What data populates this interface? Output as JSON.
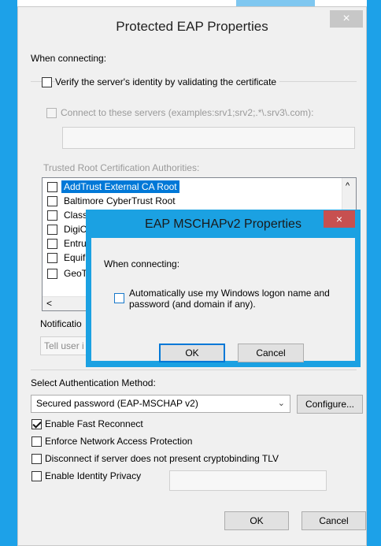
{
  "outer_dialog": {
    "title": "Protected EAP Properties",
    "close_glyph": "×",
    "when_connecting": "When connecting:",
    "verify_server_label": "Verify the server's identity by validating the certificate",
    "verify_server_checked": false,
    "connect_servers_label": "Connect to these servers (examples:srv1;srv2;.*\\.srv3\\.com):",
    "connect_servers_value": "",
    "trusted_root_label": "Trusted Root Certification Authorities:",
    "trusted_roots": [
      {
        "label": "AddTrust External CA Root",
        "checked": false,
        "selected": true
      },
      {
        "label": "Baltimore CyberTrust Root",
        "checked": false,
        "selected": false
      },
      {
        "label": "Class",
        "checked": false,
        "selected": false
      },
      {
        "label": "DigiC",
        "checked": false,
        "selected": false
      },
      {
        "label": "Entru",
        "checked": false,
        "selected": false
      },
      {
        "label": "Equif",
        "checked": false,
        "selected": false
      },
      {
        "label": "GeoT",
        "checked": false,
        "selected": false
      }
    ],
    "scroll_up_glyph": "^",
    "scroll_left_glyph": "<",
    "notifications_label": "Notificatio",
    "notifications_value": "Tell user i",
    "auth_method_label": "Select Authentication Method:",
    "auth_method_value": "Secured password (EAP-MSCHAP v2)",
    "dropdown_glyph": "⌄",
    "configure_button": "Configure...",
    "options": [
      {
        "label": "Enable Fast Reconnect",
        "checked": true
      },
      {
        "label": "Enforce Network Access Protection",
        "checked": false
      },
      {
        "label": "Disconnect if server does not present cryptobinding TLV",
        "checked": false
      },
      {
        "label": "Enable Identity Privacy",
        "checked": false
      }
    ],
    "identity_privacy_value": "",
    "ok_button": "OK",
    "cancel_button": "Cancel"
  },
  "inner_dialog": {
    "title": "EAP MSCHAPv2 Properties",
    "close_glyph": "×",
    "when_connecting": "When connecting:",
    "auto_logon_line1": "Automatically use my Windows logon name and",
    "auto_logon_line2": "password (and domain if any).",
    "auto_logon_checked": false,
    "ok_button": "OK",
    "cancel_button": "Cancel"
  },
  "colors": {
    "accent_blue": "#1ba1e2",
    "selection_blue": "#0078d7",
    "close_red": "#c75050"
  }
}
